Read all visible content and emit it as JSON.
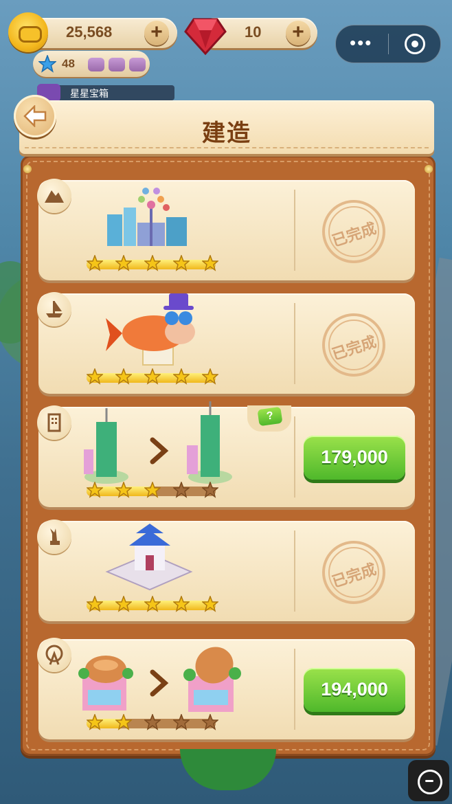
{
  "hud": {
    "coins": "25,568",
    "gems": "10",
    "plus_label": "+",
    "stars_count": "48",
    "mini_program_dots": "•••"
  },
  "hint_label": "星星宝箱",
  "panel": {
    "title": "建造"
  },
  "cards": [
    {
      "category_icon": "mountain-icon",
      "status": "done",
      "done_label": "已完成",
      "stars_filled": 5,
      "stars_total": 5,
      "art": "city-skyline"
    },
    {
      "category_icon": "ship-icon",
      "status": "done",
      "done_label": "已完成",
      "stars_filled": 5,
      "stars_total": 5,
      "art": "lucky-fish"
    },
    {
      "category_icon": "building-icon",
      "status": "upgrade",
      "price": "179,000",
      "stars_filled": 3,
      "stars_total": 5,
      "art": "taipei-101",
      "badge": "?"
    },
    {
      "category_icon": "statue-icon",
      "status": "done",
      "done_label": "已完成",
      "stars_filled": 5,
      "stars_total": 5,
      "art": "memorial-hall"
    },
    {
      "category_icon": "ferris-wheel-icon",
      "status": "upgrade",
      "price": "194,000",
      "stars_filled": 2,
      "stars_total": 5,
      "art": "bread-shop"
    }
  ],
  "colors": {
    "panel": "#b8682f",
    "card": "#f6e6c4",
    "green_button": "#5cc22f",
    "star": "#f5c518"
  }
}
